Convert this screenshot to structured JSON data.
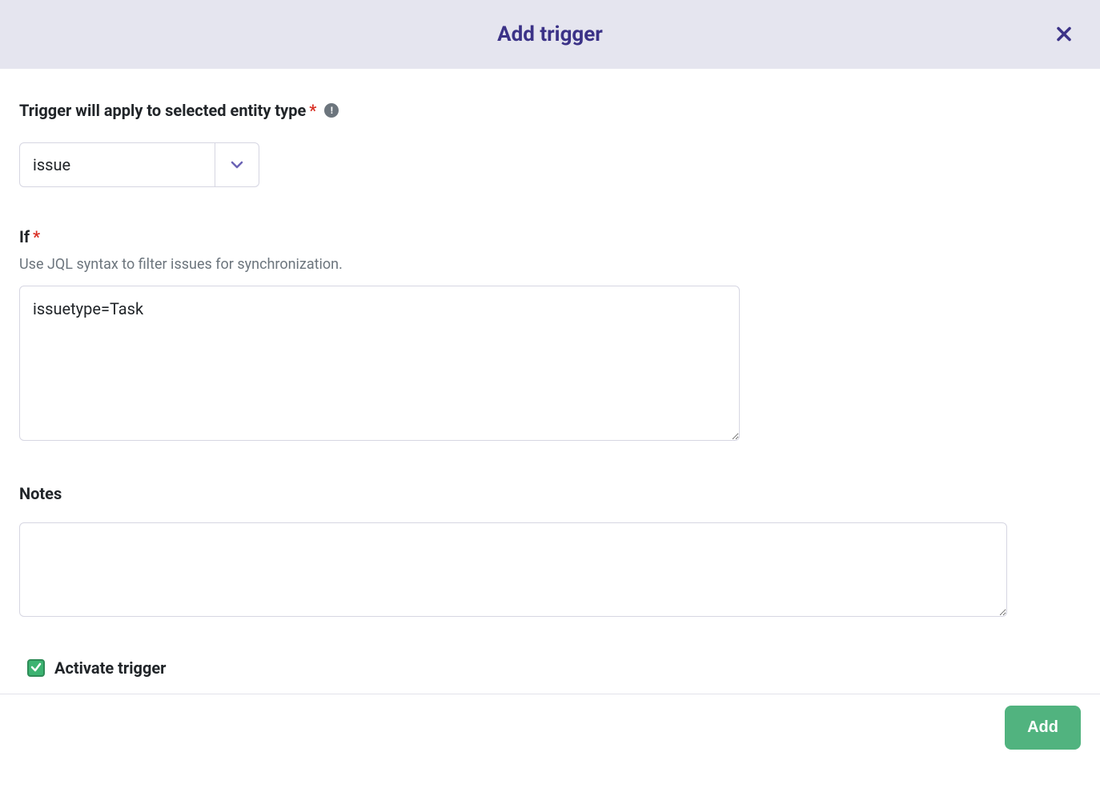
{
  "modal": {
    "title": "Add trigger"
  },
  "entityType": {
    "label": "Trigger will apply to selected entity type",
    "value": "issue"
  },
  "ifField": {
    "label": "If",
    "help": "Use JQL syntax to filter issues for synchronization.",
    "value": "issuetype=Task"
  },
  "notesField": {
    "label": "Notes",
    "value": ""
  },
  "activate": {
    "label": "Activate trigger",
    "checked": true
  },
  "footer": {
    "addLabel": "Add"
  }
}
